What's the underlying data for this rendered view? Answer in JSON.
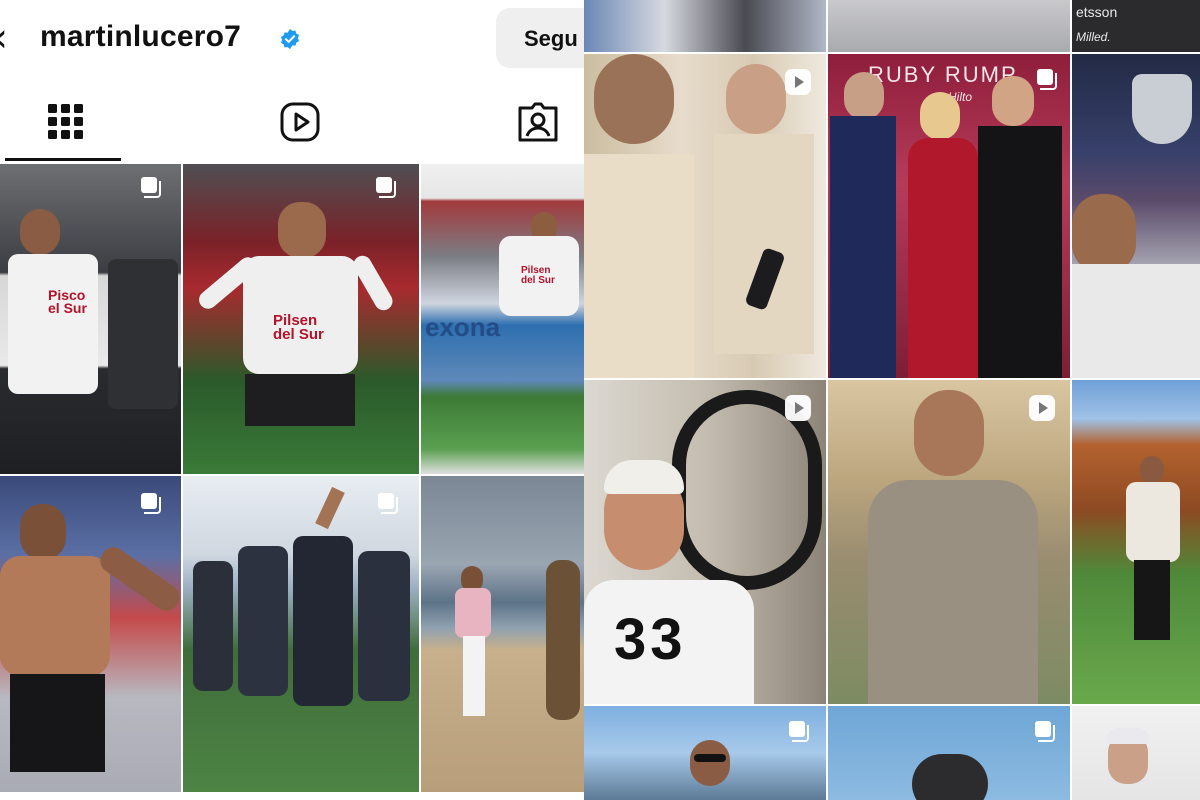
{
  "profile": {
    "username": "martinlucero7",
    "follow_label": "Segu"
  },
  "icons": {
    "back": "‹",
    "verified": "verified-badge-icon",
    "posts_tab": "grid-icon",
    "reels_tab": "reels-icon",
    "tagged_tab": "tagged-icon",
    "multi": "multiple-photos-icon",
    "play": "reel-play-icon"
  },
  "overlays": {
    "jersey_sponsor_1": "Pisco\nel Sur",
    "jersey_sponsor_2": "Pilsen\ndel Sur",
    "jersey_sponsor_3": "Pilsen\ndel Sur",
    "banner_text": "exona",
    "number_33": "33",
    "event_banner": "RUBY RUMP",
    "hilton_text": "Hilto",
    "corner_brand": "etsson",
    "corner_brand_2": "Milled."
  },
  "colors": {
    "text": "#111111",
    "verified": "#1d9bf0",
    "button_bg": "#efefef"
  }
}
